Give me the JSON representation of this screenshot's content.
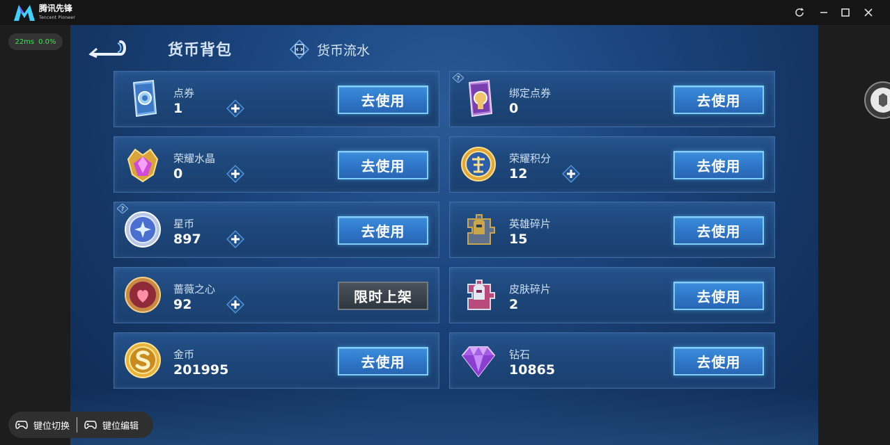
{
  "window": {
    "brand_name": "腾讯先锋",
    "brand_sub": "Tencent Pioneer",
    "controls": [
      "refresh-icon",
      "minimize-icon",
      "maximize-icon",
      "close-icon"
    ]
  },
  "status": {
    "latency": "22ms",
    "loss": "0.0%"
  },
  "game": {
    "tabs": {
      "active": "货币背包",
      "flow": "货币流水"
    },
    "currencies": [
      {
        "name": "点券",
        "amount": "1",
        "icon": "coupon-card-icon",
        "action": "去使用",
        "has_plus": true,
        "has_help": false
      },
      {
        "name": "绑定点券",
        "amount": "0",
        "icon": "bound-coupon-card-icon",
        "action": "去使用",
        "has_plus": false,
        "has_help": true
      },
      {
        "name": "荣耀水晶",
        "amount": "0",
        "icon": "glory-crystal-icon",
        "action": "去使用",
        "has_plus": true,
        "has_help": false
      },
      {
        "name": "荣耀积分",
        "amount": "12",
        "icon": "glory-points-icon",
        "action": "去使用",
        "has_plus": true,
        "has_help": false
      },
      {
        "name": "星币",
        "amount": "897",
        "icon": "star-coin-icon",
        "action": "去使用",
        "has_plus": true,
        "has_help": true
      },
      {
        "name": "英雄碎片",
        "amount": "15",
        "icon": "hero-fragment-icon",
        "action": "去使用",
        "has_plus": false,
        "has_help": false
      },
      {
        "name": "蔷薇之心",
        "amount": "92",
        "icon": "rose-heart-icon",
        "action": "限时上架",
        "has_plus": true,
        "has_help": false
      },
      {
        "name": "皮肤碎片",
        "amount": "2",
        "icon": "skin-fragment-icon",
        "action": "去使用",
        "has_plus": false,
        "has_help": false
      },
      {
        "name": "金币",
        "amount": "201995",
        "icon": "gold-coin-icon",
        "action": "去使用",
        "has_plus": false,
        "has_help": false
      },
      {
        "name": "钻石",
        "amount": "10865",
        "icon": "diamond-icon",
        "action": "去使用",
        "has_plus": false,
        "has_help": false
      }
    ]
  },
  "bottom_bar": {
    "switch_label": "键位切换",
    "edit_label": "键位编辑"
  },
  "colors": {
    "accent": "#3b8ddc",
    "panel": "#1d4679",
    "latency": "#39e84f"
  }
}
